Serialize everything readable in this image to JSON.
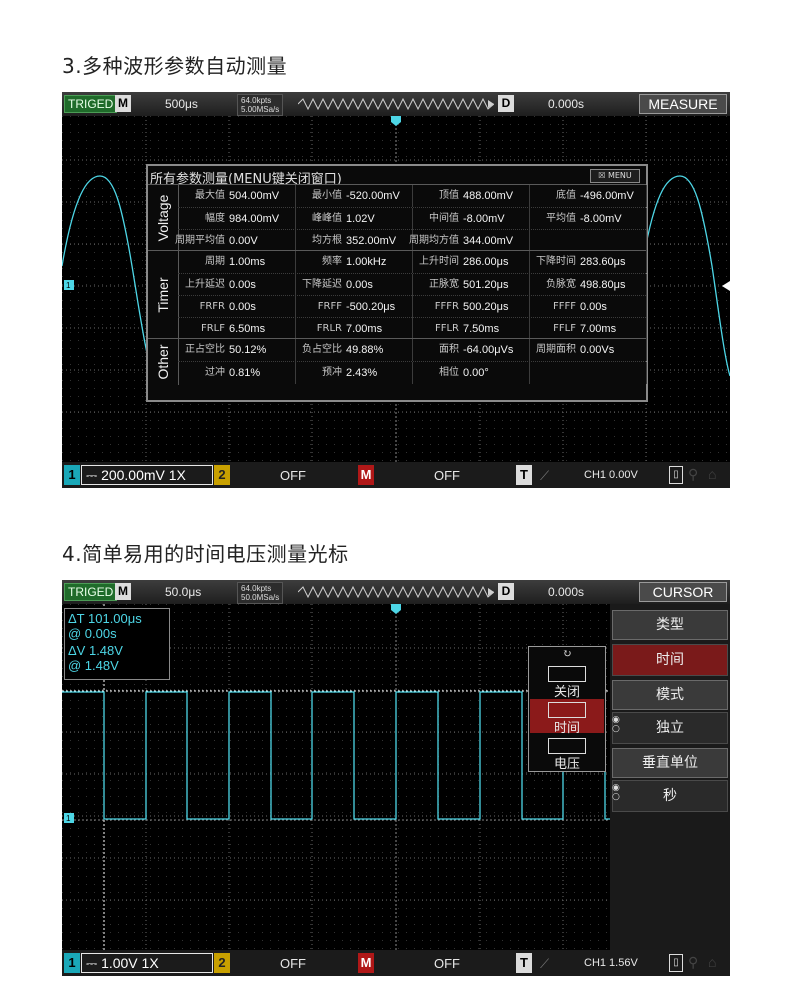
{
  "section1": {
    "heading": "3.多种波形参数自动测量",
    "topbar": {
      "trig": "TRIGED",
      "mode": "M",
      "timebase": "500μs",
      "kpts_line1": "64.0kpts",
      "kpts_line2": "5.00MSa/s",
      "d_label": "D",
      "offset": "0.000s",
      "menu_title": "MEASURE"
    },
    "bottombar": {
      "ch1_num": "1",
      "ch1_setting": "200.00mV 1X",
      "ch2_num": "2",
      "ch2_state": "OFF",
      "math_label": "M",
      "math_state": "OFF",
      "trig_label": "T",
      "trig_level": "CH1 0.00V"
    },
    "measure": {
      "title": "所有参数测量(MENU键关闭窗口)",
      "menu_badge": "MENU",
      "voltage_label": "Voltage",
      "timer_label": "Timer",
      "other_label": "Other",
      "voltage": [
        [
          {
            "k": "最大值",
            "v": "504.00mV"
          },
          {
            "k": "最小值",
            "v": "-520.00mV"
          },
          {
            "k": "顶值",
            "v": "488.00mV"
          },
          {
            "k": "底值",
            "v": "-496.00mV"
          }
        ],
        [
          {
            "k": "幅度",
            "v": "984.00mV"
          },
          {
            "k": "峰峰值",
            "v": "1.02V"
          },
          {
            "k": "中间值",
            "v": "-8.00mV"
          },
          {
            "k": "平均值",
            "v": "-8.00mV"
          }
        ],
        [
          {
            "k": "周期平均值",
            "v": "0.00V"
          },
          {
            "k": "均方根",
            "v": "352.00mV"
          },
          {
            "k": "周期均方值",
            "v": "344.00mV"
          },
          {
            "k": "",
            "v": ""
          }
        ]
      ],
      "timer": [
        [
          {
            "k": "周期",
            "v": "1.00ms"
          },
          {
            "k": "频率",
            "v": "1.00kHz"
          },
          {
            "k": "上升时间",
            "v": "286.00μs"
          },
          {
            "k": "下降时间",
            "v": "283.60μs"
          }
        ],
        [
          {
            "k": "上升延迟",
            "v": "0.00s"
          },
          {
            "k": "下降延迟",
            "v": "0.00s"
          },
          {
            "k": "正脉宽",
            "v": "501.20μs"
          },
          {
            "k": "负脉宽",
            "v": "498.80μs"
          }
        ],
        [
          {
            "k": "FRFR",
            "v": "0.00s"
          },
          {
            "k": "FRFF",
            "v": "-500.20μs"
          },
          {
            "k": "FFFR",
            "v": "500.20μs"
          },
          {
            "k": "FFFF",
            "v": "0.00s"
          }
        ],
        [
          {
            "k": "FRLF",
            "v": "6.50ms"
          },
          {
            "k": "FRLR",
            "v": "7.00ms"
          },
          {
            "k": "FFLR",
            "v": "7.50ms"
          },
          {
            "k": "FFLF",
            "v": "7.00ms"
          }
        ]
      ],
      "other": [
        [
          {
            "k": "正占空比",
            "v": "50.12%"
          },
          {
            "k": "负占空比",
            "v": "49.88%"
          },
          {
            "k": "面积",
            "v": "-64.00μVs"
          },
          {
            "k": "周期面积",
            "v": "0.00Vs"
          }
        ],
        [
          {
            "k": "过冲",
            "v": "0.81%"
          },
          {
            "k": "预冲",
            "v": "2.43%"
          },
          {
            "k": "相位",
            "v": "0.00°"
          },
          {
            "k": "",
            "v": ""
          }
        ]
      ]
    }
  },
  "section2": {
    "heading": "4.简单易用的时间电压测量光标",
    "topbar": {
      "trig": "TRIGED",
      "mode": "M",
      "timebase": "50.0μs",
      "kpts_line1": "64.0kpts",
      "kpts_line2": "50.0MSa/s",
      "d_label": "D",
      "offset": "0.000s",
      "menu_title": "CURSOR"
    },
    "bottombar": {
      "ch1_num": "1",
      "ch1_setting": "1.00V 1X",
      "ch2_num": "2",
      "ch2_state": "OFF",
      "math_label": "M",
      "math_state": "OFF",
      "trig_label": "T",
      "trig_level": "CH1 1.56V"
    },
    "readout": {
      "dt": "ΔT 101.00μs",
      "dt_at": "@  0.00s",
      "dv": "ΔV 1.48V",
      "dv_at": "@  1.48V"
    },
    "type_popup": {
      "refresh": "↻",
      "options": [
        "关闭",
        "时间",
        "电压"
      ],
      "selected": "时间"
    },
    "side_menu": {
      "type_header": "类型",
      "type_value": "时间",
      "mode_header": "模式",
      "mode_value": "独立",
      "vunit_header": "垂直单位",
      "vunit_value": "秒"
    }
  },
  "colors": {
    "trace": "#4dd6e6",
    "trig_green": "#1f6b2a",
    "ch2_yellow": "#c8a000",
    "math_red": "#b01818",
    "menu_red": "#7a1a1a"
  }
}
